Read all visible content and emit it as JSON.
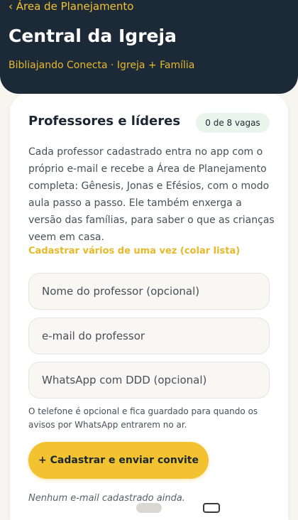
{
  "header": {
    "back_label": "‹ Área de Planejamento",
    "title": "Central da Igreja",
    "subtitle": "Bibliajando Conecta · Igreja + Família"
  },
  "card": {
    "title": "Professores e líderes",
    "badge": "0 de 8 vagas",
    "description": "Cada professor cadastrado entra no app com o próprio e-mail e recebe a Área de Planejamento completa: Gênesis, Jonas e Efésios, com o modo aula passo a passo. Ele também enxerga a versão das famílias, para saber o que as crianças veem em casa.",
    "paste_link": "Cadastrar vários de uma vez (colar lista)",
    "fields": {
      "name_placeholder": "Nome do professor (opcional)",
      "email_placeholder": "e-mail do professor",
      "whatsapp_placeholder": "WhatsApp com DDD (opcional)"
    },
    "note": "O telefone é opcional e fica guardado para quando os avisos por WhatsApp entrarem no ar.",
    "cta_label": "+ Cadastrar e enviar convite",
    "empty_state": "Nenhum e-mail cadastrado ainda."
  },
  "colors": {
    "header_bg": "#1c2a38",
    "accent": "#f2c230",
    "badge_bg": "#e9f5ec"
  }
}
